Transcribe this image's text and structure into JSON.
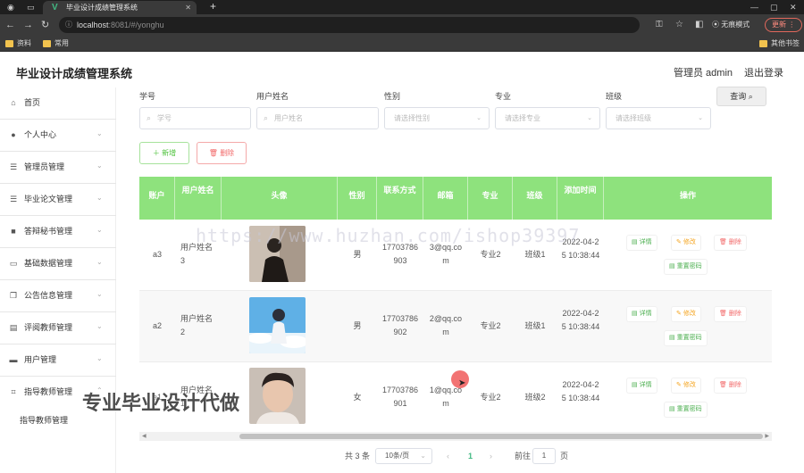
{
  "browser": {
    "tab_title": "毕业设计成绩管理系统",
    "tab_favicon": "V",
    "url_host": "localhost",
    "url_path": ":8081/#/yonghu",
    "incognito_label": "无痕模式",
    "update_label": "更新",
    "bookmarks": [
      "资料",
      "常用"
    ],
    "other_bookmarks": "其他书签"
  },
  "app": {
    "title": "毕业设计成绩管理系统",
    "user_label": "管理员 admin",
    "logout_label": "退出登录"
  },
  "sidebar": {
    "items": [
      {
        "label": "首页",
        "icon": "home-icon"
      },
      {
        "label": "个人中心",
        "icon": "user-icon"
      },
      {
        "label": "管理员管理",
        "icon": "sliders-icon"
      },
      {
        "label": "毕业论文管理",
        "icon": "sliders-icon"
      },
      {
        "label": "答辩秘书管理",
        "icon": "book-icon"
      },
      {
        "label": "基础数据管理",
        "icon": "chat-icon"
      },
      {
        "label": "公告信息管理",
        "icon": "copy-icon"
      },
      {
        "label": "评阅教师管理",
        "icon": "table-icon"
      },
      {
        "label": "用户管理",
        "icon": "folder-icon"
      },
      {
        "label": "指导教师管理",
        "icon": "crop-icon"
      }
    ],
    "subitem": "指导教师管理"
  },
  "filters": {
    "xuehao": {
      "label": "学号",
      "placeholder": "学号"
    },
    "username": {
      "label": "用户姓名",
      "placeholder": "用户姓名"
    },
    "gender": {
      "label": "性别",
      "placeholder": "请选择性别"
    },
    "major": {
      "label": "专业",
      "placeholder": "请选择专业"
    },
    "class": {
      "label": "班级",
      "placeholder": "请选择班级"
    },
    "query_label": "查询"
  },
  "actions": {
    "add_label": "新增",
    "delete_label": "删除"
  },
  "table": {
    "headers": [
      "账户",
      "用户姓名",
      "头像",
      "性别",
      "联系方式",
      "邮箱",
      "专业",
      "班级",
      "添加时间",
      "操作"
    ],
    "rows": [
      {
        "account": "a3",
        "name": "用户姓名3",
        "gender": "男",
        "phone": "17703786903",
        "email": "3@qq.com",
        "major": "专业2",
        "class": "班级1",
        "time": "2022-04-25 10:38:44"
      },
      {
        "account": "a2",
        "name": "用户姓名2",
        "gender": "男",
        "phone": "17703786902",
        "email": "2@qq.com",
        "major": "专业2",
        "class": "班级1",
        "time": "2022-04-25 10:38:44"
      },
      {
        "account": "a1",
        "name": "用户姓名1",
        "gender": "女",
        "phone": "17703786901",
        "email": "1@qq.com",
        "major": "专业2",
        "class": "班级2",
        "time": "2022-04-25 10:38:44"
      }
    ],
    "op_detail": "详情",
    "op_edit": "修改",
    "op_delete": "删除",
    "op_reset": "重置密码"
  },
  "pagination": {
    "total": "共 3 条",
    "page_size": "10条/页",
    "current_page": "1",
    "goto_label": "前往",
    "goto_value": "1",
    "page_unit": "页"
  },
  "overlays": {
    "watermark": "https://www.huzhan.com/ishop39397",
    "promo": "专业毕业设计代做"
  },
  "colors": {
    "table_header": "#8ee27d",
    "add_button": "#4cc23a",
    "delete_button": "#f26a6a",
    "edit_button": "#f5a623"
  }
}
